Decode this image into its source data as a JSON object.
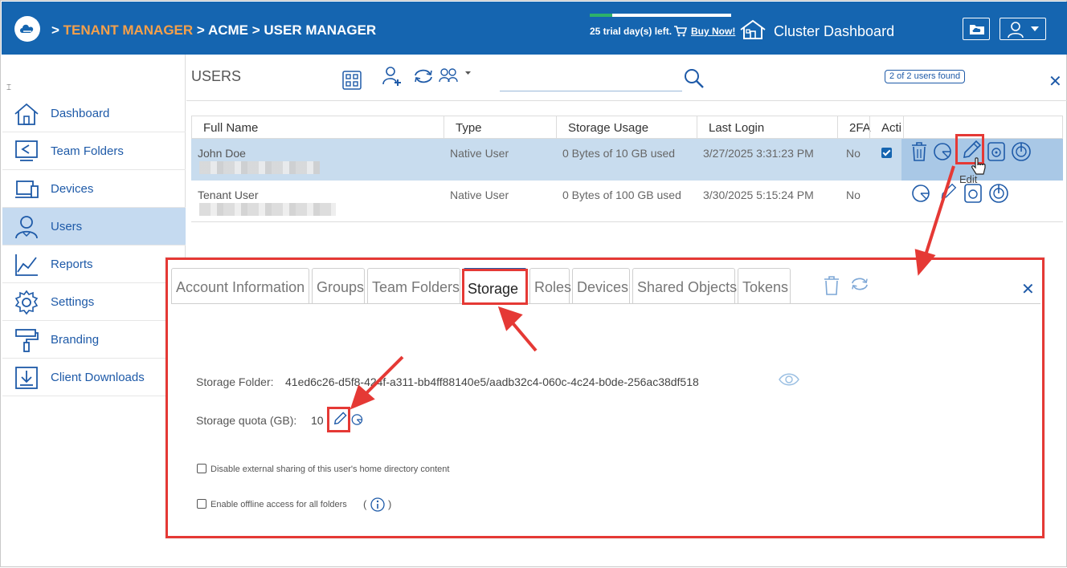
{
  "header": {
    "breadcrumb_sep": ">",
    "crumb_tenant": "TENANT MANAGER",
    "crumb_acme": "ACME",
    "crumb_user": "USER MANAGER",
    "trial_text": "25 trial day(s) left.",
    "trial_progress": 0.16,
    "buy_now": "Buy Now!",
    "cluster_dashboard": "Cluster Dashboard",
    "colors": {
      "bar": "#1565b0",
      "accent": "#f5a04a"
    }
  },
  "sidebar": {
    "items": [
      {
        "label": "Dashboard",
        "icon": "home-icon"
      },
      {
        "label": "Team Folders",
        "icon": "team-folder-icon"
      },
      {
        "label": "Devices",
        "icon": "devices-icon"
      },
      {
        "label": "Users",
        "icon": "users-icon",
        "active": true
      },
      {
        "label": "Reports",
        "icon": "reports-icon"
      },
      {
        "label": "Settings",
        "icon": "gear-icon"
      },
      {
        "label": "Branding",
        "icon": "paint-roller-icon"
      },
      {
        "label": "Client Downloads",
        "icon": "download-icon"
      }
    ]
  },
  "users": {
    "title": "USERS",
    "found_badge": "2 of 2 users found",
    "columns": [
      "Full Name",
      "Type",
      "Storage Usage",
      "Last Login",
      "2FA",
      "Acti"
    ],
    "rows": [
      {
        "name": "John Doe",
        "type": "Native User",
        "storage": "0 Bytes of 10 GB used",
        "last_login": "3/27/2025 3:31:23 PM",
        "twofa": "No",
        "active": true
      },
      {
        "name": "Tenant User",
        "type": "Native User",
        "storage": "0 Bytes of 100 GB used",
        "last_login": "3/30/2025 5:15:24 PM",
        "twofa": "No"
      }
    ],
    "edit_tooltip": "Edit"
  },
  "detail": {
    "tabs": [
      "Account Information",
      "Groups",
      "Team Folders",
      "Storage",
      "Roles",
      "Devices",
      "Shared Objects",
      "Tokens"
    ],
    "active_tab": "Storage",
    "storage_folder_label": "Storage Folder:",
    "storage_folder_value": "41ed6c26-d5f8-424f-a311-bb4ff88140e5/aadb32c4-060c-4c24-b0de-256ac38df518",
    "quota_label": "Storage quota (GB):",
    "quota_value": "10",
    "opt_disable_sharing": "Disable external sharing of this user's home directory content",
    "opt_offline": "Enable offline access for all folders",
    "paren_open": "(",
    "paren_close": ")"
  },
  "annotation_color": "#e53935"
}
